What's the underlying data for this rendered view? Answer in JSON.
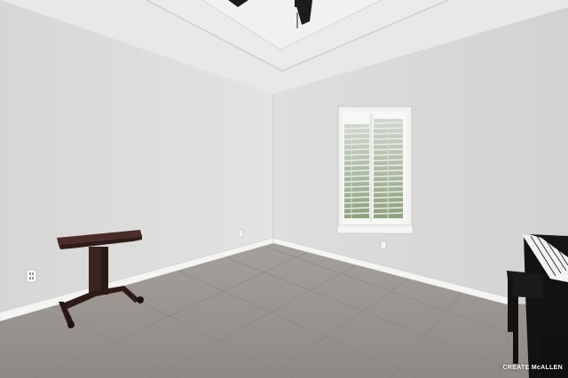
{
  "photo": {
    "watermark": "CREATE McALLEN"
  },
  "icons": {
    "ceiling_fan": "ceiling-fan-icon",
    "outlet": "outlet-icon"
  },
  "colors": {
    "wall_left": "#dfdfdd",
    "wall_right": "#d9dad8",
    "ceiling": "#e9e9e7",
    "floor": "#9a9591",
    "trim": "#f4f4f2",
    "stand": "#3e2623",
    "piano": "#121212"
  }
}
